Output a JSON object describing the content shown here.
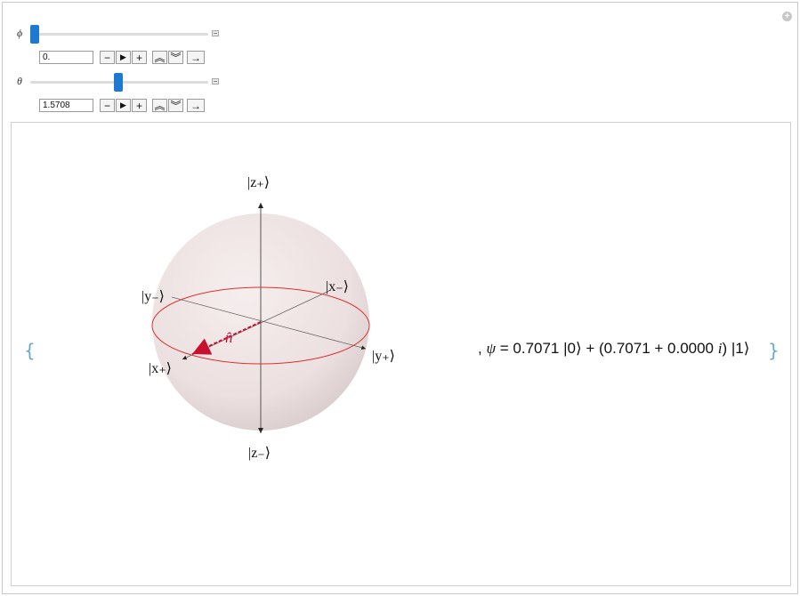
{
  "controls": [
    {
      "label": "ϕ",
      "value": "0.",
      "slider_fraction": 0.0
    },
    {
      "label": "θ",
      "value": "1.5708",
      "slider_fraction": 0.5
    }
  ],
  "animator_buttons": {
    "minus": "−",
    "play": "▶",
    "plus": "+",
    "faster": "⌃",
    "slower": "⌄",
    "direction": "→"
  },
  "sphere_labels": {
    "z_plus": "|z₊⟩",
    "z_minus": "|z₋⟩",
    "x_plus": "|x₊⟩",
    "x_minus": "|x₋⟩",
    "y_plus": "|y₊⟩",
    "y_minus": "|y₋⟩",
    "n_hat": "n̂"
  },
  "output": {
    "open_brace": "{",
    "close_brace": "}",
    "prefix": ", ",
    "psi_symbol": "ψ",
    "equals": " =  ",
    "state_text": "0.7071 |0⟩ + (0.7071 + 0.0000 ",
    "imag_unit": "i",
    "state_tail": ") |1⟩"
  },
  "colors": {
    "slider_thumb": "#1c7ad0",
    "state_vector": "#c8102e",
    "equator": "#e03030",
    "sphere": "#efe2e2"
  },
  "icons": {
    "corner": "plus-circle-icon"
  }
}
